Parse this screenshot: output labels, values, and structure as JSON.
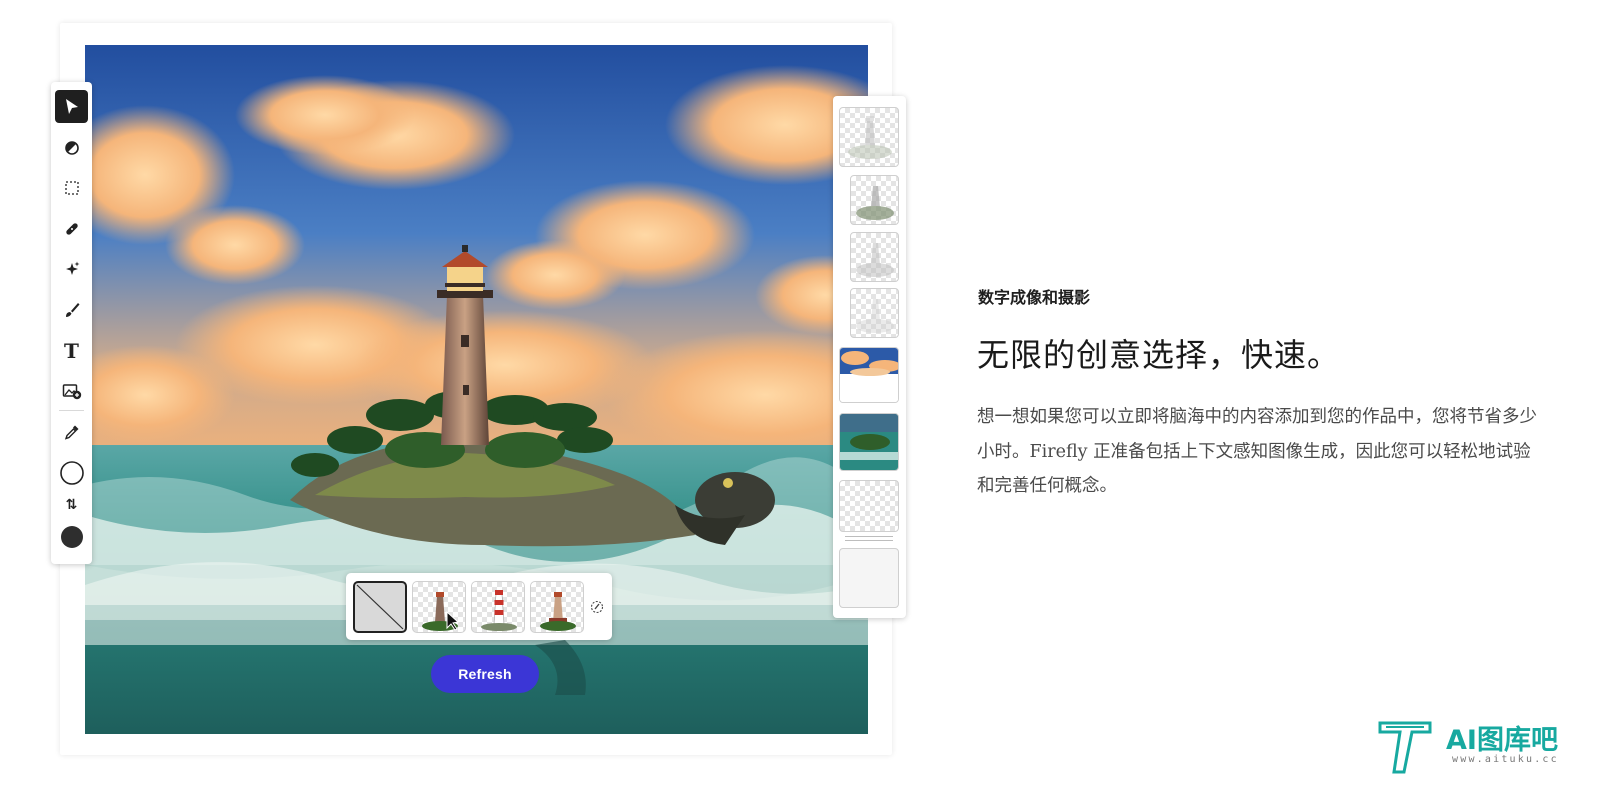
{
  "toolbar": {
    "tools": [
      {
        "name": "select",
        "icon": "arrow-pointer-icon",
        "active": true
      },
      {
        "name": "adjust",
        "icon": "contrast-icon"
      },
      {
        "name": "marquee",
        "icon": "marquee-select-icon"
      },
      {
        "name": "heal",
        "icon": "bandage-icon"
      },
      {
        "name": "generative",
        "icon": "sparkle-icon"
      },
      {
        "name": "brush",
        "icon": "brush-icon"
      },
      {
        "name": "text",
        "icon": "text-tool-icon"
      },
      {
        "name": "add-image",
        "icon": "add-image-icon"
      },
      {
        "name": "eyedropper",
        "icon": "eyedropper-icon"
      },
      {
        "name": "foreground-color",
        "icon": "color-swatch-outline-icon"
      },
      {
        "name": "swap-colors",
        "icon": "swap-arrows-icon"
      },
      {
        "name": "background-color",
        "icon": "color-swatch-filled-icon"
      }
    ],
    "text_tool_glyph": "T",
    "swap_glyph": "⇅",
    "active_color": "#1f1f1f",
    "fill_color": "#2e2e2e"
  },
  "history": {
    "items": [
      {
        "type": "lighthouse-faded"
      },
      {
        "type": "lighthouse-faded"
      },
      {
        "type": "lighthouse-faded"
      },
      {
        "type": "lighthouse-faded"
      },
      {
        "type": "sky"
      },
      {
        "type": "island"
      },
      {
        "type": "transparent"
      },
      {
        "type": "blank"
      }
    ]
  },
  "variations": {
    "items": [
      {
        "type": "none",
        "selected": true
      },
      {
        "type": "lighthouse-a"
      },
      {
        "type": "lighthouse-striped"
      },
      {
        "type": "lighthouse-b"
      }
    ],
    "more_icon": "brush-sparkle-icon"
  },
  "refresh_label": "Refresh",
  "article": {
    "eyebrow": "数字成像和摄影",
    "headline": "无限的创意选择，快速。",
    "body": "想一想如果您可以立即将脑海中的内容添加到您的作品中，您将节省多少小时。Firefly 正准备包括上下文感知图像生成，因此您可以轻松地试验和完善任何概念。"
  },
  "watermark": {
    "text": "AI图库吧",
    "url": "www.aituku.cc",
    "color": "#17a9a0"
  },
  "colors": {
    "accent": "#3b36d6",
    "sky_top": "#2c5aa8",
    "sea": "#2b8a82"
  }
}
